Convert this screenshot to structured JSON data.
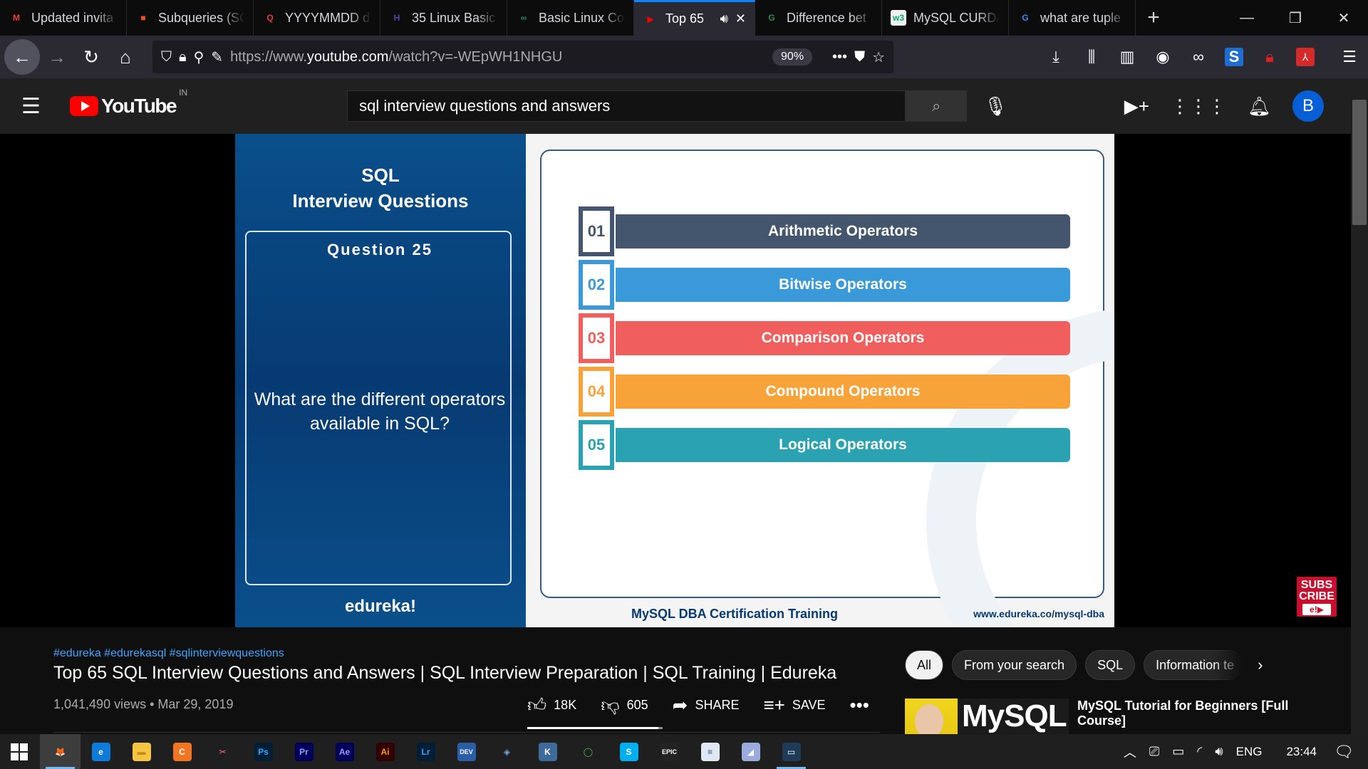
{
  "browser": {
    "tabs": [
      {
        "title": "Updated invita",
        "icon": "gmail-icon",
        "icon_glyph": "M",
        "icon_color": "#ea4335",
        "active": false
      },
      {
        "title": "Subqueries (SQ",
        "icon": "microsoft-icon",
        "icon_glyph": "■",
        "icon_color": "#f25022",
        "active": false
      },
      {
        "title": "YYYYMMDD d",
        "icon": "quora-icon",
        "icon_glyph": "Q",
        "icon_color": "#e23c3c",
        "active": false
      },
      {
        "title": "35 Linux Basic",
        "icon": "hackernoon-icon",
        "icon_glyph": "H",
        "icon_color": "#5a45a8",
        "active": false
      },
      {
        "title": "Basic Linux Co",
        "icon": "glasses-icon",
        "icon_glyph": "∞",
        "icon_color": "#1b8e7a",
        "active": false
      },
      {
        "title": "Top 65",
        "icon": "youtube-icon",
        "icon_glyph": "▶",
        "icon_color": "#ff0000",
        "active": true
      },
      {
        "title": "Difference bet",
        "icon": "geeks-icon",
        "icon_glyph": "G",
        "icon_color": "#2f8d46",
        "active": false
      },
      {
        "title": "MySQL CURDA",
        "icon": "w3schools-icon",
        "icon_glyph": "w3",
        "icon_color": "#ffffff",
        "active": false
      },
      {
        "title": "what are tuple",
        "icon": "google-icon",
        "icon_glyph": "G",
        "icon_color": "#4285f4",
        "active": false
      }
    ],
    "url_prefix": "https://www.",
    "url_domain": "youtube.com",
    "url_path": "/watch?v=-WEpWH1NHGU",
    "zoom": "90%"
  },
  "youtube": {
    "country": "IN",
    "search_query": "sql interview questions and answers",
    "avatar_letter": "B"
  },
  "slide": {
    "heading_line1": "SQL",
    "heading_line2": "Interview Questions",
    "question_number": "Question 25",
    "question_text": "What are the different operators available in SQL?",
    "brand": "edureka!",
    "operators": [
      {
        "num": "01",
        "label": "Arithmetic Operators",
        "color": "#44566e"
      },
      {
        "num": "02",
        "label": "Bitwise Operators",
        "color": "#3a9ad9"
      },
      {
        "num": "03",
        "label": "Comparison Operators",
        "color": "#f15e5e"
      },
      {
        "num": "04",
        "label": "Compound Operators",
        "color": "#f8a33a"
      },
      {
        "num": "05",
        "label": "Logical Operators",
        "color": "#2aa2b2"
      }
    ],
    "footer_course": "MySQL DBA Certification Training",
    "footer_url": "www.edureka.co/mysql-dba",
    "subscribe_line1": "SUBS",
    "subscribe_line2": "CRIBE"
  },
  "video": {
    "hashtags": "#edureka #edurekasql #sqlinterviewquestions",
    "title": "Top 65 SQL Interview Questions and Answers | SQL Interview Preparation | SQL Training | Edureka",
    "meta": "1,041,490 views • Mar 29, 2019",
    "likes": "18K",
    "dislikes": "605",
    "share_label": "SHARE",
    "save_label": "SAVE",
    "like_ratio": 0.967
  },
  "sidebar": {
    "chips": [
      "All",
      "From your search",
      "SQL",
      "Information te"
    ],
    "rec_thumb_text": "MySQL",
    "rec_title": "MySQL Tutorial for Beginners [Full Course]"
  },
  "taskbar": {
    "apps": [
      {
        "name": "firefox-app",
        "glyph": "🦊",
        "bg": "transparent",
        "fg": "#ff7139",
        "active": true
      },
      {
        "name": "edge-app",
        "glyph": "e",
        "bg": "#0f7bd8",
        "fg": "#fff"
      },
      {
        "name": "file-explorer-app",
        "glyph": "▬",
        "bg": "#f4c542",
        "fg": "#c48a12"
      },
      {
        "name": "crunchyroll-app",
        "glyph": "C",
        "bg": "#f47521",
        "fg": "#fff"
      },
      {
        "name": "snipping-app",
        "glyph": "✂",
        "bg": "transparent",
        "fg": "#ff6a6a"
      },
      {
        "name": "photoshop-app",
        "glyph": "Ps",
        "bg": "#001e36",
        "fg": "#31a8ff"
      },
      {
        "name": "premiere-app",
        "glyph": "Pr",
        "bg": "#00005b",
        "fg": "#9999ff"
      },
      {
        "name": "after-effects-app",
        "glyph": "Ae",
        "bg": "#00005b",
        "fg": "#9999ff"
      },
      {
        "name": "illustrator-app",
        "glyph": "Ai",
        "bg": "#330000",
        "fg": "#ff9a00"
      },
      {
        "name": "lightroom-app",
        "glyph": "Lr",
        "bg": "#001e36",
        "fg": "#31a8ff"
      },
      {
        "name": "devc-app",
        "glyph": "DEV",
        "bg": "#2a5fa8",
        "fg": "#fff"
      },
      {
        "name": "virtualbox-app",
        "glyph": "◈",
        "bg": "transparent",
        "fg": "#6fa8dc"
      },
      {
        "name": "vmware-app",
        "glyph": "K",
        "bg": "#3e6b9a",
        "fg": "#fff"
      },
      {
        "name": "sync-app",
        "glyph": "◯",
        "bg": "transparent",
        "fg": "#3ac34a"
      },
      {
        "name": "skype-app",
        "glyph": "S",
        "bg": "#00aff0",
        "fg": "#fff"
      },
      {
        "name": "epic-games-app",
        "glyph": "EPIC",
        "bg": "#222",
        "fg": "#fff"
      },
      {
        "name": "notepad-app",
        "glyph": "≡",
        "bg": "#dfe8f5",
        "fg": "#356"
      },
      {
        "name": "paint-app",
        "glyph": "◢",
        "bg": "#9ad",
        "fg": "#fff"
      },
      {
        "name": "mysql-workbench-app",
        "glyph": "▭",
        "bg": "#1f3b57",
        "fg": "#fff",
        "running": true
      }
    ],
    "lang": "ENG",
    "time": "23:44"
  }
}
